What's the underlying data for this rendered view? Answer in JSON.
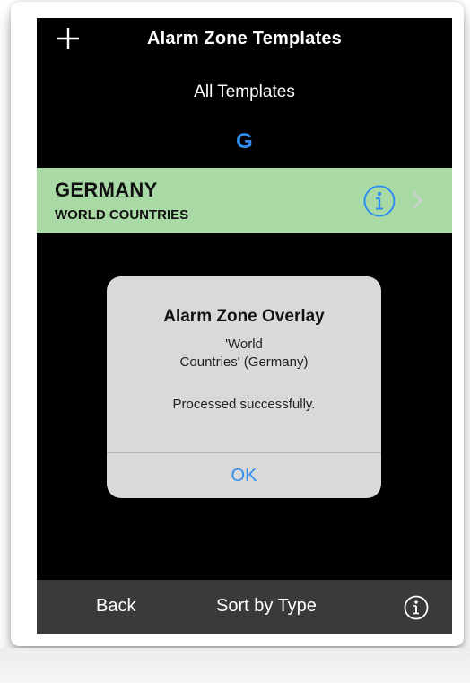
{
  "navbar": {
    "title": "Alarm Zone Templates",
    "add_icon": "plus-icon"
  },
  "list": {
    "subtitle": "All Templates",
    "section_letter": "G",
    "rows": [
      {
        "title": "GERMANY",
        "subtitle": "WORLD COUNTRIES",
        "info_icon": "info-icon",
        "chevron_icon": "chevron-right-icon"
      }
    ]
  },
  "alert": {
    "title": "Alarm Zone Overlay",
    "message_line1": "'World",
    "message_line2": "Countries' (Germany)",
    "message_status": "Processed successfully.",
    "ok_label": "OK"
  },
  "toolbar": {
    "back_label": "Back",
    "sort_label": "Sort by Type",
    "info_icon": "info-icon"
  },
  "colors": {
    "accent": "#2f8ff0",
    "row_highlight": "#a9d9a5",
    "toolbar_bg": "#3a3a3a",
    "alert_bg": "#d9d9d9"
  }
}
